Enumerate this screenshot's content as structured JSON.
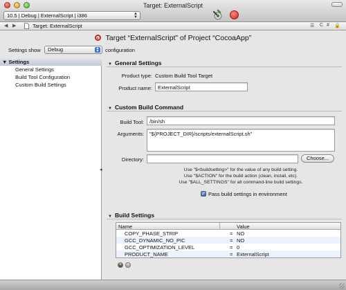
{
  "window": {
    "title": "Target: ExternalScript",
    "active_config": "10.5 | Debug | ExternalScript | i386"
  },
  "navbar": {
    "back_glyph": "◀",
    "forward_glyph": "▶",
    "path": "Target: ExternalScript"
  },
  "header": {
    "target_title": "Target “ExternalScript” of Project “CocoaApp”",
    "settings_show_label": "Settings show",
    "configuration_value": "Debug",
    "configuration_suffix": "configuration"
  },
  "sidebar": {
    "root_label": "Settings",
    "items": [
      {
        "label": "General Settings"
      },
      {
        "label": "Build Tool Configuration"
      },
      {
        "label": "Custom Build Settings"
      }
    ]
  },
  "general_settings": {
    "header": "General Settings",
    "product_type_label": "Product type:",
    "product_type_value": "Custom Build Tool Target",
    "product_name_label": "Product name:",
    "product_name_value": "ExternalScript"
  },
  "custom_build_command": {
    "header": "Custom Build Command",
    "build_tool_label": "Build Tool:",
    "build_tool_value": "/bin/sh",
    "arguments_label": "Arguments:",
    "arguments_value": "\"${PROJECT_DIR}/scripts/externalScript.sh\"",
    "directory_label": "Directory:",
    "directory_value": "",
    "choose_button": "Choose...",
    "help_lines": [
      "Use \"$<buildsetting>\" for the value of any build setting.",
      "Use \"$ACTION\" for the build action (clean, install, etc).",
      "Use \"$ALL_SETTINGS\" for all command-line build settings."
    ],
    "pass_settings_label": "Pass build settings in environment",
    "pass_settings_checked": true
  },
  "build_settings": {
    "header": "Build Settings",
    "columns": {
      "name": "Name",
      "value": "Value"
    },
    "rows": [
      {
        "name": "COPY_PHASE_STRIP",
        "eq": "=",
        "value": "NO"
      },
      {
        "name": "GCC_DYNAMIC_NO_PIC",
        "eq": "=",
        "value": "NO"
      },
      {
        "name": "GCC_OPTIMIZATION_LEVEL",
        "eq": "=",
        "value": "0"
      },
      {
        "name": "PRODUCT_NAME",
        "eq": "=",
        "value": "ExternalScript"
      }
    ],
    "add_glyph": "+",
    "remove_glyph": "−"
  },
  "colors": {
    "accent": "#3b74d6",
    "target_icon": "#c0271c",
    "stop": "#c8221b"
  }
}
